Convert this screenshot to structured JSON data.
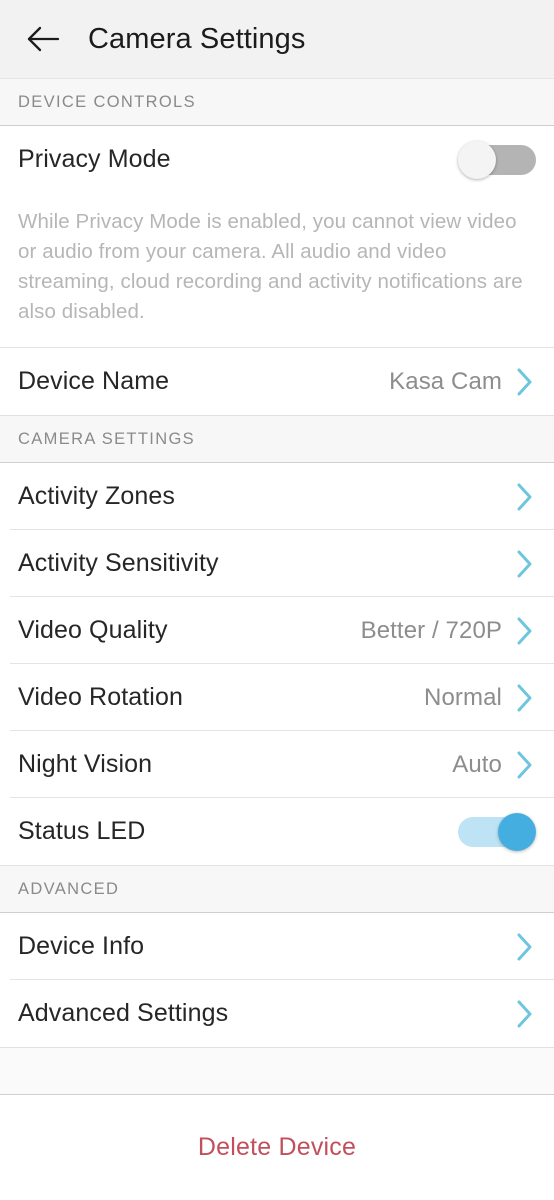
{
  "header": {
    "title": "Camera Settings",
    "back_icon": "arrow-left-icon"
  },
  "sections": [
    {
      "id": "device-controls",
      "title": "DEVICE CONTROLS"
    },
    {
      "id": "camera-settings",
      "title": "CAMERA SETTINGS"
    },
    {
      "id": "advanced",
      "title": "ADVANCED"
    }
  ],
  "device_controls": {
    "privacy_mode": {
      "label": "Privacy Mode",
      "toggle_state": "off"
    },
    "privacy_description": "While Privacy Mode is enabled, you cannot view video or audio from your camera. All audio and video streaming, cloud recording and activity notifications are also disabled.",
    "device_name": {
      "label": "Device Name",
      "value": "Kasa Cam",
      "chevron_icon": "chevron-right-icon"
    }
  },
  "camera_settings": {
    "activity_zones": {
      "label": "Activity Zones",
      "value": "",
      "chevron_icon": "chevron-right-icon"
    },
    "activity_sensitivity": {
      "label": "Activity Sensitivity",
      "value": "",
      "chevron_icon": "chevron-right-icon"
    },
    "video_quality": {
      "label": "Video Quality",
      "value": "Better / 720P",
      "chevron_icon": "chevron-right-icon"
    },
    "video_rotation": {
      "label": "Video Rotation",
      "value": "Normal",
      "chevron_icon": "chevron-right-icon"
    },
    "night_vision": {
      "label": "Night Vision",
      "value": "Auto",
      "chevron_icon": "chevron-right-icon"
    },
    "status_led": {
      "label": "Status LED",
      "toggle_state": "on"
    }
  },
  "advanced": {
    "device_info": {
      "label": "Device Info",
      "chevron_icon": "chevron-right-icon"
    },
    "advanced_settings": {
      "label": "Advanced Settings",
      "chevron_icon": "chevron-right-icon"
    }
  },
  "footer": {
    "delete_label": "Delete Device"
  },
  "colors": {
    "accent_chevron": "#6ec6de",
    "toggle_on_knob": "#45aee0",
    "toggle_on_track": "#bde3f5",
    "toggle_off_track": "#b4b4b4",
    "delete_red": "#c2505c",
    "header_bg": "#f2f2f2",
    "section_bg": "#f7f7f7",
    "label_text": "#262626",
    "value_text": "#8d8d8d",
    "section_text": "#8a8a8a",
    "description_text": "#b6b6b6"
  }
}
